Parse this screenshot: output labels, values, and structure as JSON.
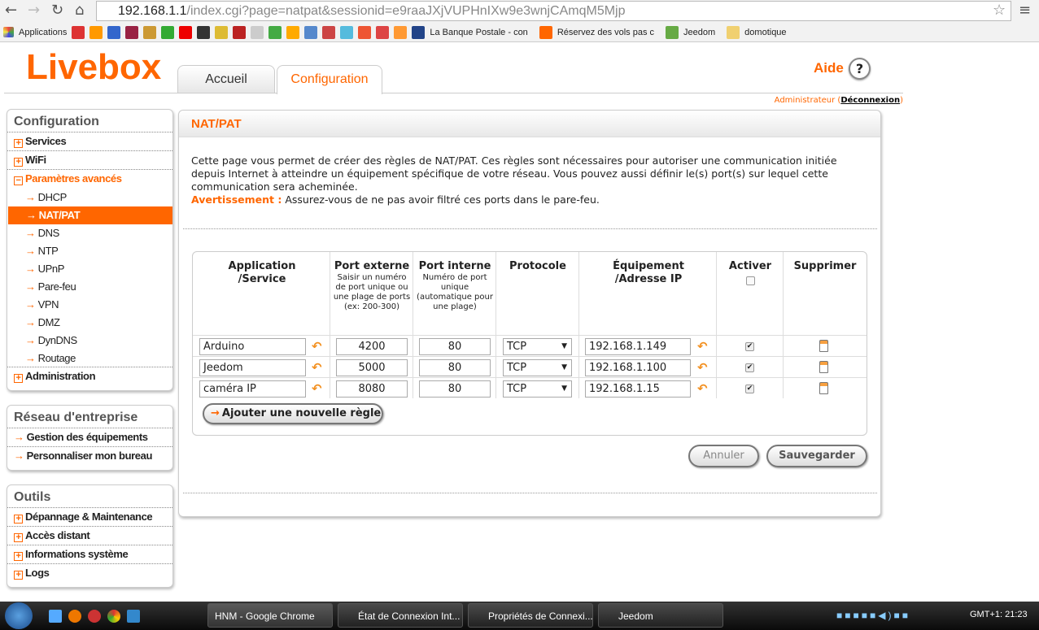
{
  "browser": {
    "url_host": "192.168.1.1",
    "url_path": "/index.cgi?page=natpat&sessionid=e9raaJXjVUPHnIXw9e3wnjCAmqM5Mjp",
    "bookmarks": [
      "Applications",
      "La Banque Postale - con",
      "Réservez des vols pas c",
      "Jeedom",
      "domotique"
    ]
  },
  "header": {
    "logo": "Livebox",
    "tabs": [
      "Accueil",
      "Configuration"
    ],
    "help": "Aide",
    "help_icon": "?",
    "admin": "Administrateur",
    "logout": "Déconnexion"
  },
  "sidebar": {
    "config_title": "Configuration",
    "config_items": [
      "Services",
      "WiFi",
      "Paramètres avancés"
    ],
    "sub_items": [
      "DHCP",
      "NAT/PAT",
      "DNS",
      "NTP",
      "UPnP",
      "Pare-feu",
      "VPN",
      "DMZ",
      "DynDNS",
      "Routage"
    ],
    "admin_item": "Administration",
    "reseau_title": "Réseau d'entreprise",
    "reseau_items": [
      "Gestion des équipements",
      "Personnaliser mon bureau"
    ],
    "outils_title": "Outils",
    "outils_items": [
      "Dépannage & Maintenance",
      "Accès distant",
      "Informations système",
      "Logs"
    ]
  },
  "main": {
    "title": "NAT/PAT",
    "description": "Cette page vous permet de créer des règles de NAT/PAT. Ces règles sont nécessaires pour autoriser une communication initiée depuis Internet à atteindre un équipement spécifique de votre réseau. Vous pouvez aussi définir le(s) port(s) sur lequel cette communication sera acheminée.",
    "warning_label": "Avertissement :",
    "warning_text": " Assurez-vous de ne pas avoir filtré ces ports dans le pare-feu.",
    "columns": {
      "app": "Application /Service",
      "ext": "Port externe",
      "ext_hint": "Saisir un numéro de port unique ou une plage de ports (ex: 200-300)",
      "int": "Port interne",
      "int_hint": "Numéro de port unique (automatique pour une plage)",
      "proto": "Protocole",
      "ip": "Équipement /Adresse IP",
      "activer": "Activer",
      "suppr": "Supprimer"
    },
    "rules": [
      {
        "app": "Arduino",
        "ext": "4200",
        "int": "80",
        "proto": "TCP",
        "ip": "192.168.1.149",
        "active": true
      },
      {
        "app": "Jeedom",
        "ext": "5000",
        "int": "80",
        "proto": "TCP",
        "ip": "192.168.1.100",
        "active": true
      },
      {
        "app": "caméra IP",
        "ext": "8080",
        "int": "80",
        "proto": "TCP",
        "ip": "192.168.1.15",
        "active": true
      }
    ],
    "add_rule": "Ajouter une nouvelle règle",
    "cancel": "Annuler",
    "save": "Sauvegarder"
  },
  "taskbar": {
    "tasks": [
      "HNM - Google Chrome",
      "État de Connexion Int...",
      "Propriétés de Connexi...",
      "Jeedom"
    ],
    "clock": "GMT+1: 21:23"
  }
}
